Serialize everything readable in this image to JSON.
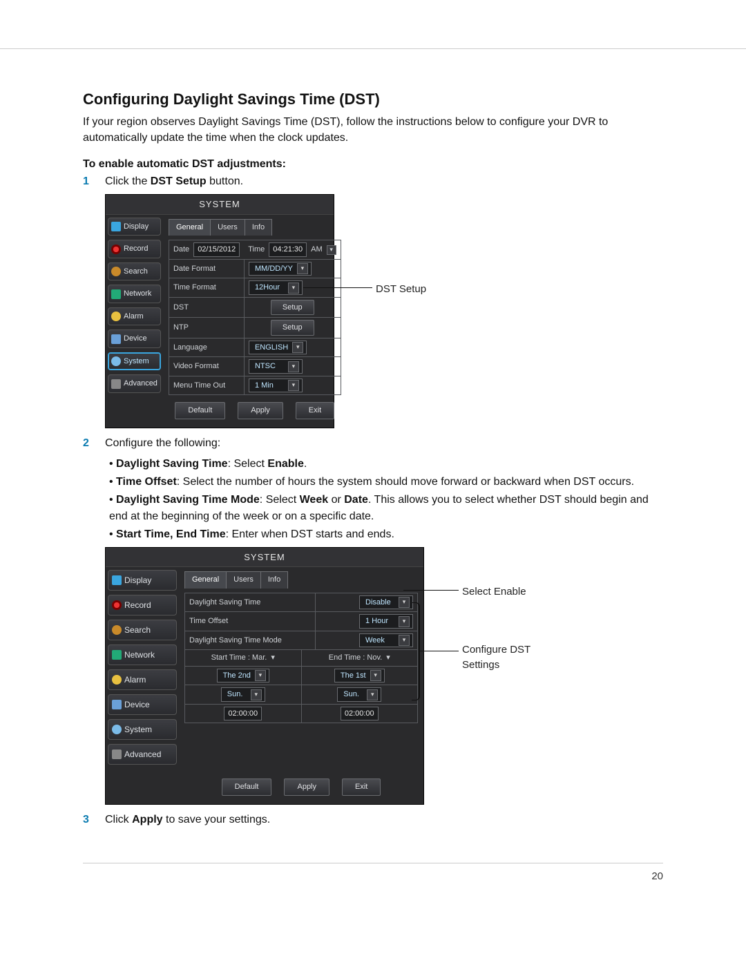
{
  "page_number": "20",
  "heading": "Configuring Daylight Savings Time (DST)",
  "intro": "If your region observes Daylight Savings Time (DST), follow the instructions below to configure your DVR to automatically update the time when the clock updates.",
  "subhead": "To enable automatic DST adjustments:",
  "step1_prefix": "Click the ",
  "step1_bold": "DST Setup",
  "step1_suffix": " button.",
  "step2_lead": "Configure the following:",
  "step3_prefix": "Click ",
  "step3_bold": "Apply",
  "step3_suffix": " to save your settings.",
  "b1_bold": "Daylight Saving Time",
  "b1_mid": ": Select ",
  "b1_bold2": "Enable",
  "b1_suffix": ".",
  "b2_bold": "Time Offset",
  "b2_rest": ": Select the number of hours the system should move forward or backward when DST occurs.",
  "b3_bold": "Daylight Saving Time Mode",
  "b3_mid": ": Select ",
  "b3_bold2": "Week",
  "b3_mid2": " or ",
  "b3_bold3": "Date",
  "b3_rest": ". This allows you to select whether DST should begin and end at the beginning of the week or on a specific date.",
  "b4_bold": "Start Time, End Time",
  "b4_rest": ": Enter when DST starts and ends.",
  "callout_dst_setup": "DST Setup",
  "callout_select_enable": "Select Enable",
  "callout_configure": "Configure DST Settings",
  "dvr": {
    "window_title": "SYSTEM",
    "sidebar": [
      "Display",
      "Record",
      "Search",
      "Network",
      "Alarm",
      "Device",
      "System",
      "Advanced"
    ],
    "tabs": [
      "General",
      "Users",
      "Info"
    ],
    "date_label": "Date",
    "date_value": "02/15/2012",
    "time_label": "Time",
    "time_value": "04:21:30",
    "time_ampm": "AM",
    "rows": {
      "date_format_lbl": "Date Format",
      "date_format_val": "MM/DD/YY",
      "time_format_lbl": "Time Format",
      "time_format_val": "12Hour",
      "dst_lbl": "DST",
      "dst_btn": "Setup",
      "ntp_lbl": "NTP",
      "ntp_btn": "Setup",
      "lang_lbl": "Language",
      "lang_val": "ENGLISH",
      "vfmt_lbl": "Video Format",
      "vfmt_val": "NTSC",
      "timeout_lbl": "Menu Time Out",
      "timeout_val": "1 Min"
    },
    "buttons": {
      "default": "Default",
      "apply": "Apply",
      "exit": "Exit"
    }
  },
  "dvr2": {
    "rows": {
      "dst_lbl": "Daylight Saving Time",
      "dst_val": "Disable",
      "offset_lbl": "Time Offset",
      "offset_val": "1 Hour",
      "mode_lbl": "Daylight Saving Time Mode",
      "mode_val": "Week",
      "start_lbl": "Start Time : Mar.",
      "end_lbl": "End Time :  Nov.",
      "start_ord": "The 2nd",
      "end_ord": "The 1st",
      "start_day": "Sun.",
      "end_day": "Sun.",
      "start_hms": "02:00:00",
      "end_hms": "02:00:00"
    }
  }
}
